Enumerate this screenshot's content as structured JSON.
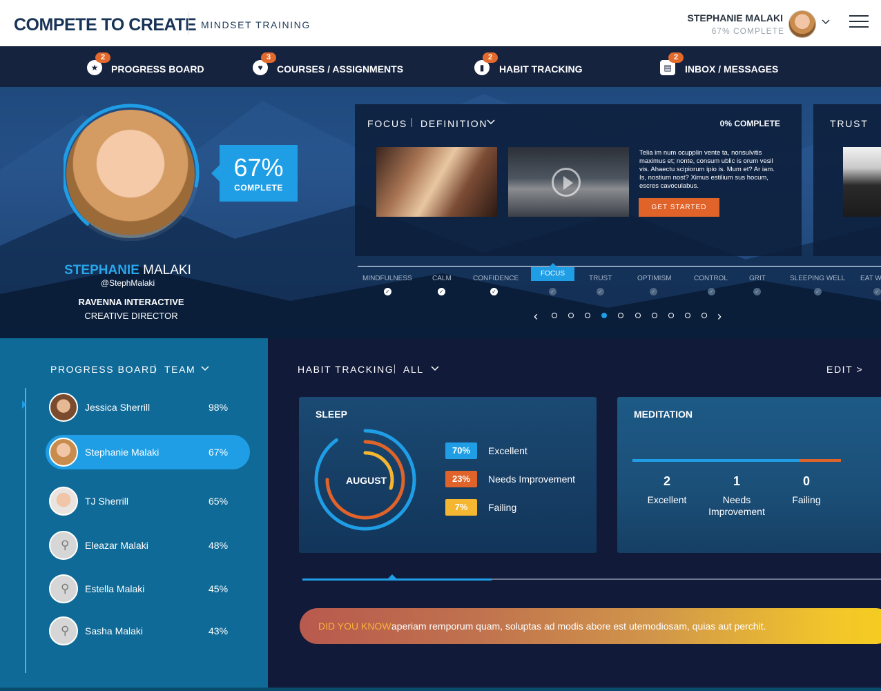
{
  "header": {
    "logo": "COMPETE TO CREATE",
    "subtitle": "MINDSET TRAINING",
    "user_name": "STEPHANIE MALAKI",
    "user_progress": "67% COMPLETE"
  },
  "nav": {
    "items": [
      {
        "label": "PROGRESS BOARD",
        "badge": "2",
        "icon": "star-icon"
      },
      {
        "label": "COURSES / ASSIGNMENTS",
        "badge": "3",
        "icon": "heart-icon"
      },
      {
        "label": "HABIT TRACKING",
        "badge": "2",
        "icon": "bar-chart-icon"
      },
      {
        "label": "INBOX / MESSAGES",
        "badge": "2",
        "icon": "inbox-icon"
      }
    ]
  },
  "profile": {
    "percent": "67%",
    "percent_label": "COMPLETE",
    "progress": 0.67,
    "first_name": "STEPHANIE",
    "last_name": "MALAKI",
    "handle": "@StephMalaki",
    "company": "RAVENNA INTERACTIVE",
    "role": "CREATIVE DIRECTOR"
  },
  "focus_card": {
    "title": "FOCUS",
    "filter": "DEFINITION",
    "complete": "0% COMPLETE",
    "description": "Telia im num ocupplin vente ta, nonsulvitis maximus et; nonte, consum ublic is orum vesil vis. Ahaectu scipiorum ipio is. Mum et? Ar iam. Is, nostium nost? Ximus estilium sus hocum, escres cavoculabus.",
    "cta": "GET STARTED"
  },
  "next_card": {
    "title": "TRUST"
  },
  "timeline": {
    "topics": [
      {
        "label": "MINDFULNESS",
        "done": true
      },
      {
        "label": "CALM",
        "done": true
      },
      {
        "label": "CONFIDENCE",
        "done": true
      },
      {
        "label": "FOCUS",
        "done": false,
        "active": true
      },
      {
        "label": "TRUST",
        "done": false
      },
      {
        "label": "OPTIMISM",
        "done": false
      },
      {
        "label": "CONTROL",
        "done": false
      },
      {
        "label": "GRIT",
        "done": false
      },
      {
        "label": "SLEEPING WELL",
        "done": false
      },
      {
        "label": "EAT W",
        "done": false
      }
    ],
    "check": "✓",
    "prev": "‹",
    "next": "›"
  },
  "progress_board": {
    "title": "PROGRESS BOARD",
    "filter": "TEAM",
    "members": [
      {
        "name": "Jessica Sherrill",
        "pct": "98%"
      },
      {
        "name": "Stephanie Malaki",
        "pct": "67%"
      },
      {
        "name": "TJ Sherrill",
        "pct": "65%"
      },
      {
        "name": "Eleazar Malaki",
        "pct": "48%"
      },
      {
        "name": "Estella Malaki",
        "pct": "45%"
      },
      {
        "name": "Sasha Malaki",
        "pct": "43%"
      }
    ]
  },
  "habit": {
    "title": "HABIT TRACKING",
    "filter": "ALL",
    "edit": "EDIT >",
    "sleep": {
      "title": "SLEEP",
      "center": "AUGUST",
      "legend": [
        {
          "value": "70%",
          "label": "Excellent",
          "color": "#1f9ee6"
        },
        {
          "value": "23%",
          "label": "Needs Improvement",
          "color": "#e0632a"
        },
        {
          "value": "7%",
          "label": "Failing",
          "color": "#f5b731"
        }
      ]
    },
    "meditation": {
      "title": "MEDITATION",
      "stats": [
        {
          "value": "2",
          "label": "Excellent"
        },
        {
          "value": "1",
          "label": "Needs Improvement"
        },
        {
          "value": "0",
          "label": "Failing"
        }
      ]
    }
  },
  "did_you_know": {
    "label": "DID YOU KNOW:",
    "text": "aperiam remporum quam, soluptas ad modis abore est utemodiosam, quias aut perchit."
  },
  "colors": {
    "accent": "#1f9ee6",
    "orange": "#e0632a",
    "yellow": "#f5b731",
    "navy": "#16233f"
  }
}
